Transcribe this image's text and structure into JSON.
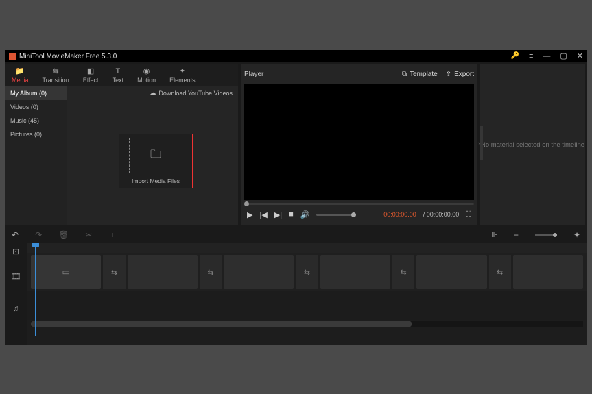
{
  "titlebar": {
    "title": "MiniTool MovieMaker Free 5.3.0"
  },
  "tabs": {
    "media": "Media",
    "transition": "Transition",
    "effect": "Effect",
    "text": "Text",
    "motion": "Motion",
    "elements": "Elements"
  },
  "sidebar": {
    "myalbum": "My Album (0)",
    "videos": "Videos (0)",
    "music": "Music (45)",
    "pictures": "Pictures (0)"
  },
  "media": {
    "download": "Download YouTube Videos",
    "import": "Import Media Files"
  },
  "player": {
    "title": "Player",
    "template": "Template",
    "export": "Export",
    "time_current": "00:00:00.00",
    "time_sep": " / ",
    "time_total": "00:00:00.00"
  },
  "properties": {
    "empty": "No material selected on the timeline"
  }
}
